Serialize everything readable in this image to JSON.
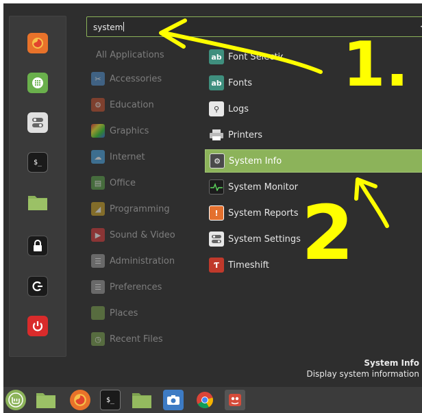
{
  "search": {
    "value": "system"
  },
  "categories": [
    {
      "label": "All Applications"
    },
    {
      "label": "Accessories"
    },
    {
      "label": "Education"
    },
    {
      "label": "Graphics"
    },
    {
      "label": "Internet"
    },
    {
      "label": "Office"
    },
    {
      "label": "Programming"
    },
    {
      "label": "Sound & Video"
    },
    {
      "label": "Administration"
    },
    {
      "label": "Preferences"
    },
    {
      "label": "Places"
    },
    {
      "label": "Recent Files"
    }
  ],
  "apps": [
    {
      "label": "Font Selection"
    },
    {
      "label": "Fonts"
    },
    {
      "label": "Logs"
    },
    {
      "label": "Printers"
    },
    {
      "label": "System Info"
    },
    {
      "label": "System Monitor"
    },
    {
      "label": "System Reports"
    },
    {
      "label": "System Settings"
    },
    {
      "label": "Timeshift"
    }
  ],
  "selected_app": {
    "title": "System Info",
    "description": "Display system information"
  },
  "annotations": {
    "step1": "1.",
    "step2": "2"
  },
  "colors": {
    "accent": "#8cb35a",
    "annotation": "#ffff00",
    "panel": "#2e2e2e"
  }
}
